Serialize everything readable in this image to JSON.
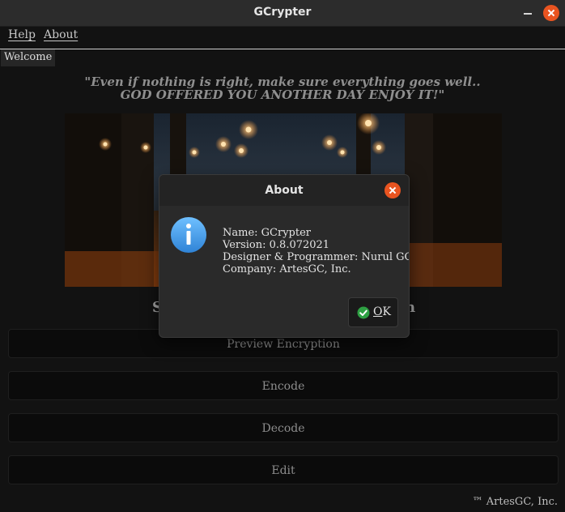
{
  "window": {
    "title": "GCrypter"
  },
  "menu": {
    "help": "Help",
    "about": "About"
  },
  "tabs": {
    "welcome": "Welcome"
  },
  "quote": {
    "line1": "\"Even if nothing is right, make sure everything goes well..",
    "line2": "GOD OFFERED YOU ANOTHER DAY ENJOY IT!\""
  },
  "subtitle": {
    "left": "S",
    "right": "n"
  },
  "buttons": {
    "preview": "Preview Encryption",
    "encode": "Encode",
    "decode": "Decode",
    "edit": "Edit"
  },
  "footer": {
    "text": "™ ArtesGC, Inc."
  },
  "dialog": {
    "title": "About",
    "lines": [
      "Name: GCrypter",
      "Version: 0.8.072021",
      "Designer & Programmer: Nurul GC",
      "Company: ArtesGC, Inc."
    ],
    "ok_mnemonic": "O",
    "ok_rest": "K"
  },
  "colors": {
    "accent": "#e95420",
    "info": "#3f9be0",
    "ok_green": "#2ea043"
  },
  "icons": {
    "info": "info-icon",
    "ok": "checkmark-icon",
    "close": "close-icon",
    "minimize": "minimize-icon"
  }
}
